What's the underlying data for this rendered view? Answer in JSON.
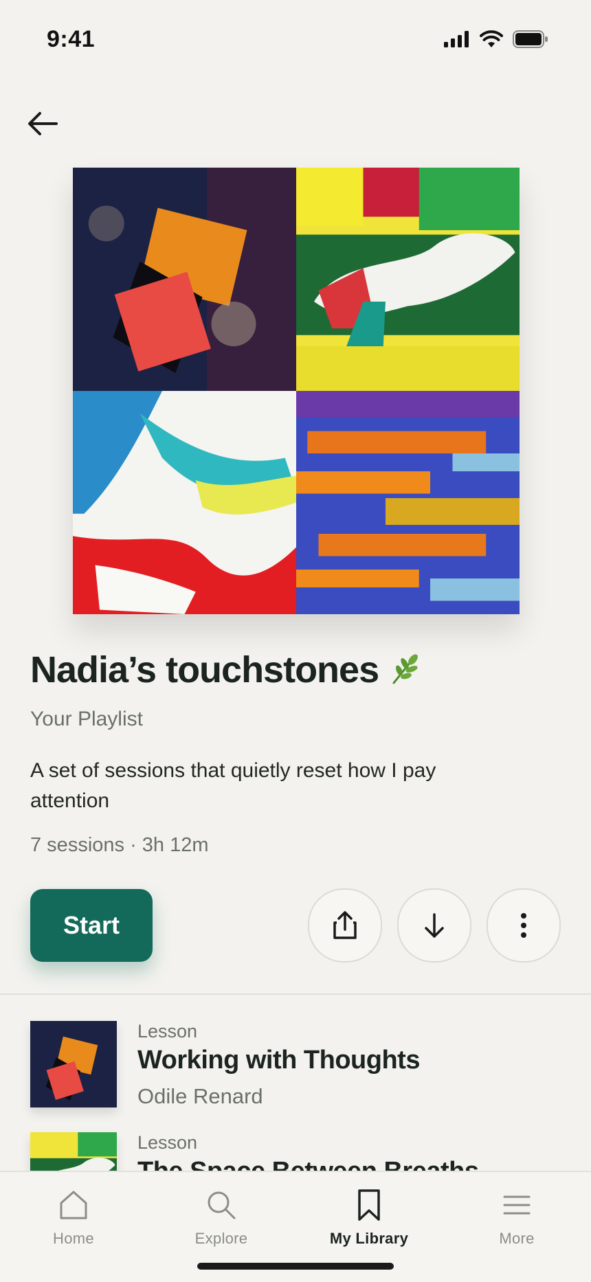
{
  "status_bar": {
    "time": "9:41"
  },
  "playlist": {
    "title": "Nadia’s touchstones",
    "subtitle": "Your Playlist",
    "description": "A set of sessions that quietly reset how I pay attention",
    "meta": "7 sessions · 3h 12m",
    "start_label": "Start"
  },
  "actions": {
    "share_icon": "share-icon",
    "download_icon": "download-icon",
    "more_icon": "more-vertical-icon"
  },
  "items": [
    {
      "kind": "Lesson",
      "title": "Working with Thoughts",
      "author": "Odile Renard"
    },
    {
      "kind": "Lesson",
      "title": "The Space Between Breaths",
      "author": ""
    }
  ],
  "tabs": [
    {
      "label": "Home",
      "icon": "home-icon"
    },
    {
      "label": "Explore",
      "icon": "search-icon"
    },
    {
      "label": "My Library",
      "icon": "bookmark-icon",
      "active": true
    },
    {
      "label": "More",
      "icon": "menu-icon"
    }
  ],
  "colors": {
    "accent": "#146a5a",
    "background": "#f3f2ee"
  }
}
